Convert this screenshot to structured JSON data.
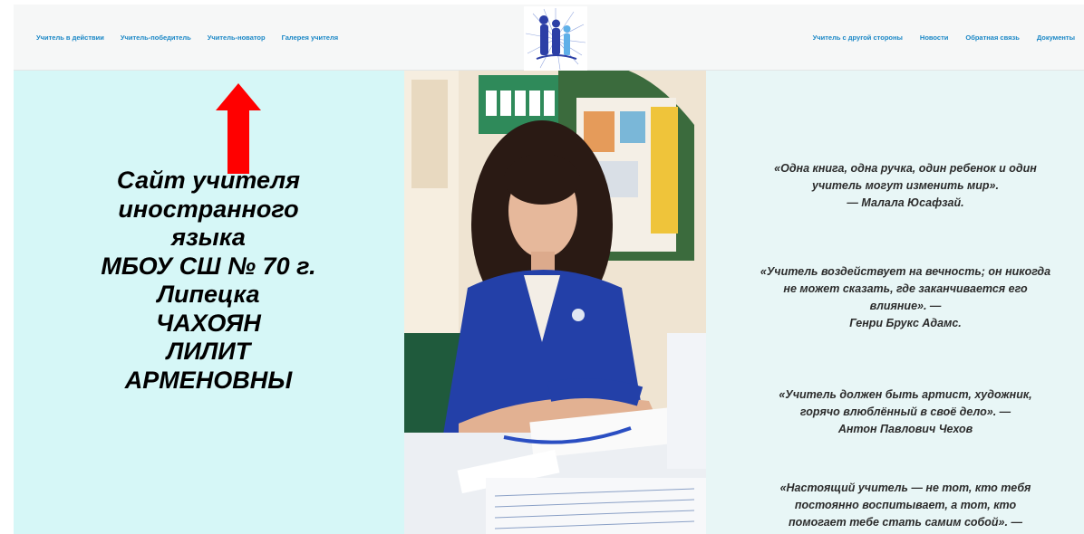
{
  "header": {
    "nav_left": [
      "Учитель в действии",
      "Учитель-победитель",
      "Учитель-новатор",
      "Галерея учителя"
    ],
    "nav_right": [
      "Учитель с другой стороны",
      "Новости",
      "Обратная связь",
      "Документы"
    ],
    "logo_icon": "school-logo-icon",
    "link_color": "#1a87c6"
  },
  "left_panel": {
    "title_lines": [
      "Сайт учителя",
      "иностранного",
      "языка",
      "МБОУ СШ № 70 г.",
      "Липецка",
      "ЧАХОЯН",
      "ЛИЛИТ",
      "АРМЕНОВНЫ"
    ],
    "arrow_icon": "red-up-arrow-icon",
    "arrow_color": "#ff0000",
    "background": "#d6f7f7"
  },
  "photo": {
    "icon": "teacher-photo"
  },
  "quotes": [
    {
      "lines": [
        "«Одна книга, одна ручка, один ребенок и один",
        "учитель могут изменить мир».",
        "— Малала Юсафзай."
      ]
    },
    {
      "lines": [
        "«Учитель воздействует на вечность; он никогда",
        "не может сказать, где заканчивается его",
        "влияние». —",
        "Генри Брукс Адамс."
      ]
    },
    {
      "lines": [
        "«Учитель должен быть артист, художник,",
        "горячо влюблённый в своё дело». —",
        "Антон Павлович Чехов"
      ]
    },
    {
      "lines": [
        "«Настоящий учитель — не тот, кто тебя",
        "постоянно воспитывает, а тот, кто",
        "помогает тебе стать самим собой». —"
      ]
    }
  ]
}
